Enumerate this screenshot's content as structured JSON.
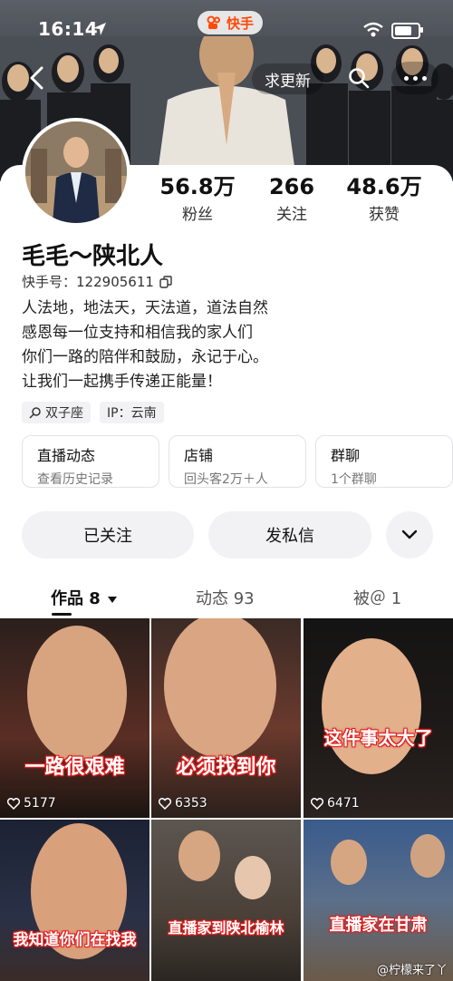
{
  "status_bar": {
    "time": "16:14"
  },
  "app_badge": "快手",
  "header": {
    "update_label": "求更新"
  },
  "profile": {
    "name": "毛毛～陕北人",
    "kuaishou_id_label": "快手号：",
    "kuaishou_id": "122905611",
    "stats": [
      {
        "value": "56.8万",
        "label": "粉丝"
      },
      {
        "value": "266",
        "label": "关注"
      },
      {
        "value": "48.6万",
        "label": "获赞"
      }
    ],
    "bio": [
      "人法地，地法天，天法道，道法自然",
      "感恩每一位支持和相信我的家人们",
      "你们一路的陪伴和鼓励，永记于心。",
      "让我们一起携手传递正能量！"
    ],
    "tags": {
      "zodiac": "双子座",
      "ip": "IP：云南"
    }
  },
  "cards": [
    {
      "title": "直播动态",
      "sub": "查看历史记录"
    },
    {
      "title": "店铺",
      "sub": "回头客2万＋人"
    },
    {
      "title": "群聊",
      "sub": "1个群聊"
    }
  ],
  "actions": {
    "followed": "已关注",
    "message": "发私信"
  },
  "tabs": [
    {
      "label": "作品 8"
    },
    {
      "label": "动态 93"
    },
    {
      "label": "被＠ 1"
    }
  ],
  "videos": [
    {
      "caption": "一路很艰难",
      "likes": "5177"
    },
    {
      "caption": "必须找到你",
      "likes": "6353"
    },
    {
      "caption": "这件事太大了",
      "likes": "6471"
    },
    {
      "caption": "我知道你们在找我",
      "likes": ""
    },
    {
      "caption": "直播家到陕北榆林",
      "likes": ""
    },
    {
      "caption": "直播家在甘肃",
      "likes": ""
    }
  ],
  "watermark": "@柠檬来了丫",
  "colors": {
    "accent": "#ff4906",
    "caption_stroke": "#e02020"
  }
}
